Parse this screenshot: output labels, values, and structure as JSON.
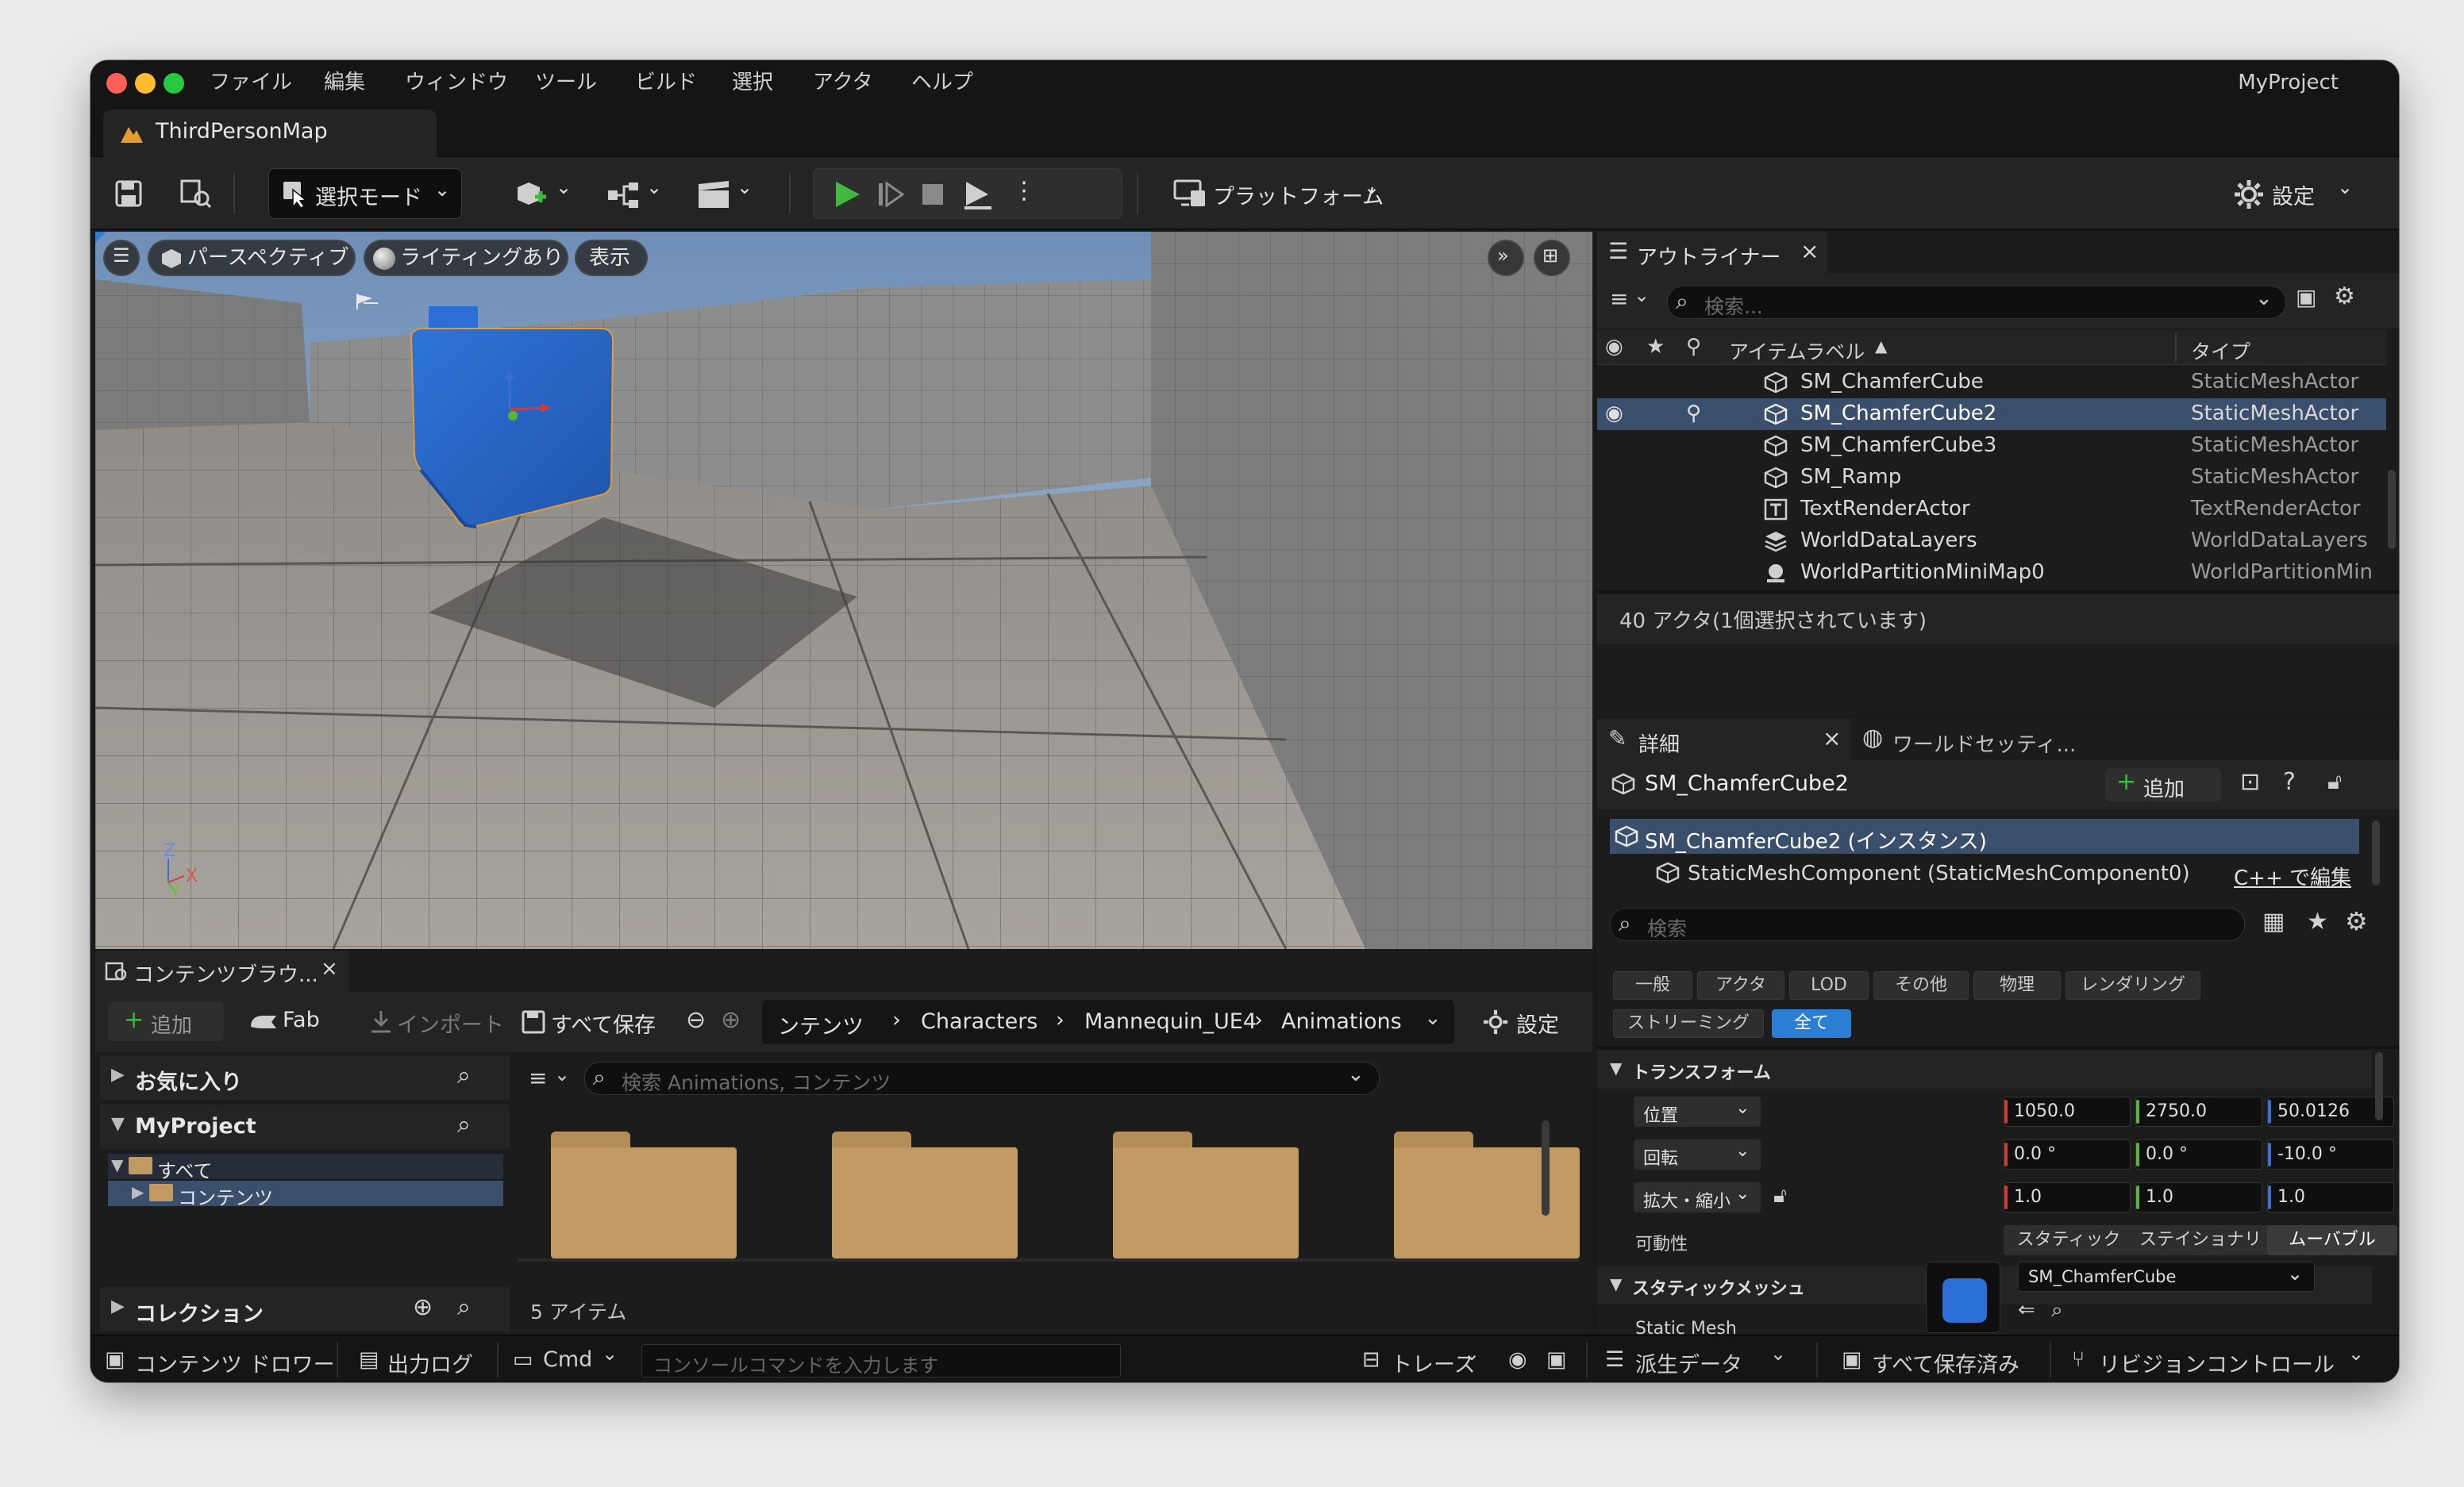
{
  "menubar": {
    "items": [
      "ファイル",
      "編集",
      "ウィンドウ",
      "ツール",
      "ビルド",
      "選択",
      "アクタ",
      "ヘルプ"
    ],
    "project_name": "MyProject"
  },
  "doc_tab": {
    "title": "ThirdPersonMap"
  },
  "toolbar": {
    "select_mode": "選択モード",
    "platform": "プラットフォーム",
    "settings": "設定"
  },
  "viewport": {
    "perspective": "パースペクティブ",
    "lighting": "ライティングあり",
    "show": "表示",
    "axis_x": "X",
    "axis_y": "Y",
    "axis_z": "Z"
  },
  "content_browser": {
    "tab_title": "コンテンツブラウ...",
    "add": "追加",
    "fab": "Fab",
    "import": "インポート",
    "save_all": "すべて保存",
    "breadcrumb": [
      "ンテンツ",
      "Characters",
      "Mannequin_UE4",
      "Animations"
    ],
    "settings": "設定",
    "favorites": "お気に入り",
    "project": "MyProject",
    "tree": [
      "すべて",
      "コンテンツ"
    ],
    "collections": "コレクション",
    "search_placeholder": "検索 Animations, コンテンツ",
    "item_count": "5 アイテム"
  },
  "statusbar": {
    "content_drawer": "コンテンツ ドロワー",
    "output_log": "出力ログ",
    "cmd": "Cmd",
    "console_placeholder": "コンソールコマンドを入力します",
    "trace": "トレース",
    "derived_data": "派生データ",
    "all_saved": "すべて保存済み",
    "revision_control": "リビジョンコントロール"
  },
  "outliner": {
    "tab_title": "アウトライナー",
    "search_placeholder": "検索...",
    "col_label": "アイテムラベル",
    "col_type": "タイプ",
    "rows": [
      {
        "name": "SM_ChamferCube",
        "type": "StaticMeshActor",
        "selected": false
      },
      {
        "name": "SM_ChamferCube2",
        "type": "StaticMeshActor",
        "selected": true
      },
      {
        "name": "SM_ChamferCube3",
        "type": "StaticMeshActor",
        "selected": false
      },
      {
        "name": "SM_Ramp",
        "type": "StaticMeshActor",
        "selected": false
      },
      {
        "name": "TextRenderActor",
        "type": "TextRenderActor",
        "selected": false
      },
      {
        "name": "WorldDataLayers",
        "type": "WorldDataLayers",
        "selected": false
      },
      {
        "name": "WorldPartitionMiniMap0",
        "type": "WorldPartitionMin",
        "selected": false
      }
    ],
    "footer": "40 アクタ(1個選択されています)"
  },
  "details": {
    "tab_title": "詳細",
    "world_settings_tab": "ワールドセッティ...",
    "actor_name": "SM_ChamferCube2",
    "add": "追加",
    "instance": "SM_ChamferCube2 (インスタンス)",
    "component": "StaticMeshComponent (StaticMeshComponent0)",
    "edit_cpp": "C++ で編集",
    "search_placeholder": "検索",
    "categories_row1": [
      "一般",
      "アクタ",
      "LOD",
      "その他",
      "物理",
      "レンダリング"
    ],
    "categories_row2": [
      "ストリーミング",
      "全て"
    ],
    "transform_header": "トランスフォーム",
    "location_label": "位置",
    "location": [
      "1050.0",
      "2750.0",
      "50.0126"
    ],
    "rotation_label": "回転",
    "rotation": [
      "0.0 °",
      "0.0 °",
      "-10.0 °"
    ],
    "scale_label": "拡大・縮小",
    "scale": [
      "1.0",
      "1.0",
      "1.0"
    ],
    "mobility_label": "可動性",
    "mobility_options": [
      "スタティック",
      "ステイショナリ",
      "ムーバブル"
    ],
    "static_mesh_header": "スタティックメッシュ",
    "static_mesh_label": "Static Mesh",
    "static_mesh_value": "SM_ChamferCube"
  },
  "colors": {
    "accent_blue": "#2a7fd4",
    "selected_row": "#3a4f6b",
    "play_green": "#3fba3f",
    "axis_red": "#d33b3b",
    "axis_green": "#5db335",
    "axis_blue": "#3b6fd4",
    "folder": "#c09a62",
    "cube_blue": "#2b6fd6"
  }
}
